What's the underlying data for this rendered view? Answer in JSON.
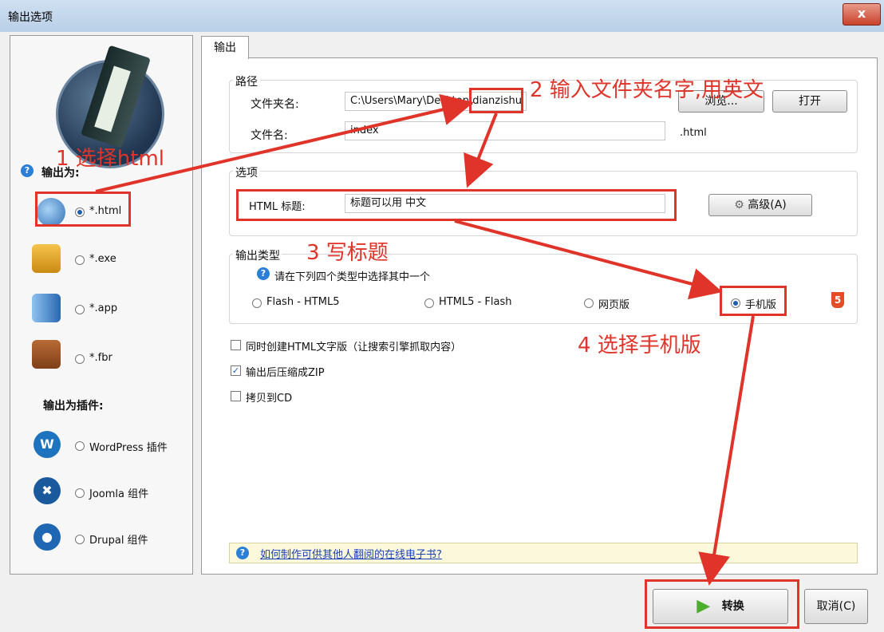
{
  "window": {
    "title": "输出选项",
    "close_label": "x"
  },
  "tab": {
    "label": "输出"
  },
  "left": {
    "output_as_heading": "输出为:",
    "options": [
      {
        "label": "*.html",
        "selected": true,
        "icon": "globe-icon"
      },
      {
        "label": "*.exe",
        "selected": false,
        "icon": "setup-package-icon"
      },
      {
        "label": "*.app",
        "selected": false,
        "icon": "mac-finder-icon"
      },
      {
        "label": "*.fbr",
        "selected": false,
        "icon": "book-icon"
      }
    ],
    "plugin_heading": "输出为插件:",
    "plugins": [
      {
        "label": "WordPress 插件",
        "icon": "wordpress-icon",
        "color": "#1e73be"
      },
      {
        "label": "Joomla 组件",
        "icon": "joomla-icon",
        "color": "#1a5a9c"
      },
      {
        "label": "Drupal 组件",
        "icon": "drupal-icon",
        "color": "#1f66b3"
      }
    ]
  },
  "path": {
    "title": "路径",
    "folder_label": "文件夹名:",
    "folder_value": "C:\\Users\\Mary\\Desktop\\dianzishu",
    "browse_label": "浏览...",
    "open_label": "打开",
    "file_label": "文件名:",
    "file_value": "index",
    "ext": ".html"
  },
  "options": {
    "title": "选项",
    "html_title_label": "HTML 标题:",
    "html_title_value": "标题可以用 中文",
    "advanced_label": "高级(A)"
  },
  "output_type": {
    "title": "输出类型",
    "hint": "请在下列四个类型中选择其中一个",
    "choices": [
      {
        "label": "Flash - HTML5",
        "selected": false
      },
      {
        "label": "HTML5 - Flash",
        "selected": false
      },
      {
        "label": "网页版",
        "selected": false
      },
      {
        "label": "手机版",
        "selected": true
      }
    ]
  },
  "checkboxes": [
    {
      "label": "同时创建HTML文字版（让搜索引擎抓取内容）",
      "checked": false
    },
    {
      "label": "输出后压缩成ZIP",
      "checked": true
    },
    {
      "label": "拷贝到CD",
      "checked": false
    }
  ],
  "help": {
    "link": "如何制作可供其他人翻阅的在线电子书?"
  },
  "footer": {
    "convert_label": "转换",
    "cancel_label": "取消(C)"
  },
  "annotations": {
    "step1": "1 选择html",
    "step2": "2 输入文件夹名字,用英文",
    "step3": "3 写标题",
    "step4": "4 选择手机版"
  },
  "colors": {
    "annotation": "#e0342a",
    "link": "#1b3fb8",
    "accent": "#1d5fb0"
  }
}
